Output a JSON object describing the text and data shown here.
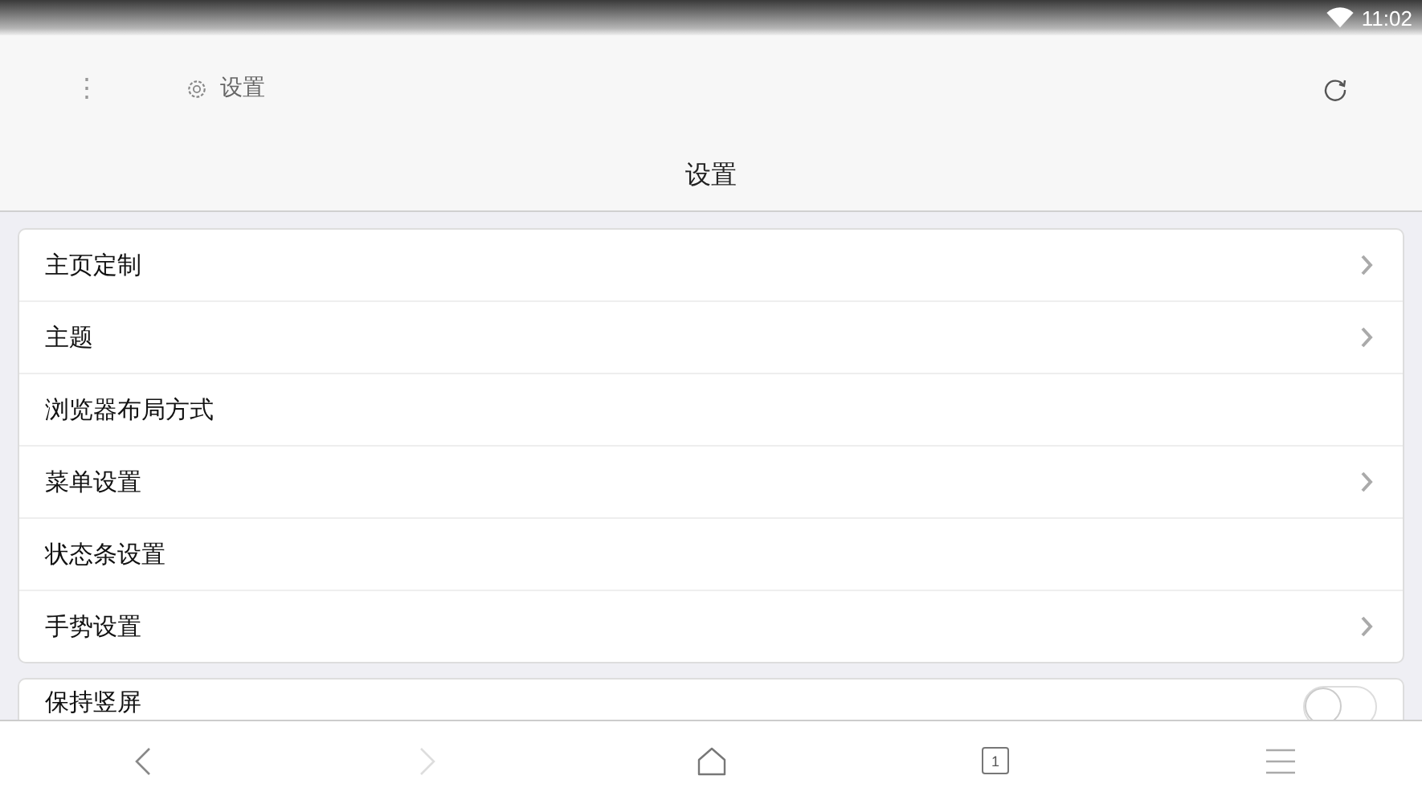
{
  "status_bar": {
    "time": "11:02"
  },
  "toolbar": {
    "menu_icon": "⋮",
    "page_title": "设置"
  },
  "title_bar": {
    "title": "设置"
  },
  "groups": [
    {
      "items": [
        {
          "label": "主页定制",
          "kind": "link",
          "chevron": true
        },
        {
          "label": "主题",
          "kind": "link",
          "chevron": true
        },
        {
          "label": "浏览器布局方式",
          "kind": "link",
          "chevron": false
        },
        {
          "label": "菜单设置",
          "kind": "link",
          "chevron": true
        },
        {
          "label": "状态条设置",
          "kind": "link",
          "chevron": false
        },
        {
          "label": "手势设置",
          "kind": "link",
          "chevron": true
        }
      ]
    },
    {
      "items": [
        {
          "label": "保持竖屏",
          "kind": "toggle",
          "on": false
        }
      ]
    }
  ],
  "nav_bar": [
    {
      "kind": "back",
      "disabled": false
    },
    {
      "kind": "forward",
      "disabled": true
    },
    {
      "kind": "home",
      "disabled": false
    },
    {
      "kind": "tabs",
      "count": "1",
      "disabled": false
    },
    {
      "kind": "menu",
      "disabled": false
    }
  ]
}
